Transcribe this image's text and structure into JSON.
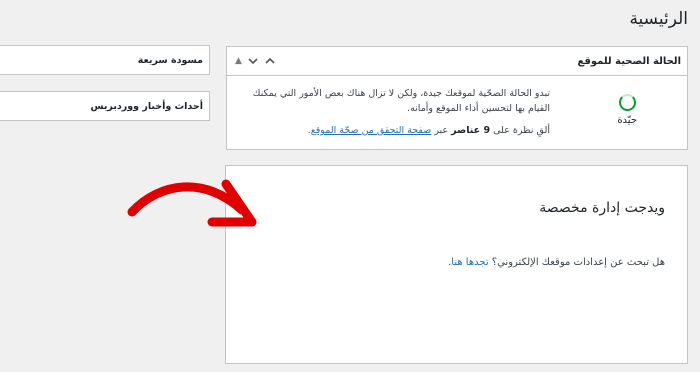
{
  "page": {
    "title": "الرئيسية"
  },
  "site_health": {
    "title": "الحالة الصحية للموقع",
    "status_label": "جيّدة",
    "paragraph1": "تبدو الحالة الصحّية لموقعك جيدة، ولكن لا تزال هناك بعض الأمور التي يمكنك القيام بها لتحسين أداء الموقع وأمانه.",
    "p2_prefix": "ألقِ نظرة على ",
    "p2_count": "9 عناصر",
    "p2_mid": " عبر ",
    "p2_link": "صفحة التحقق من صحّة الموقع",
    "p2_suffix": "."
  },
  "handles": {
    "up": "▲",
    "down": "▼",
    "up_arrow": "⌃"
  },
  "side": {
    "quick_draft": "مسودة سريعة",
    "wp_news": "أحداث وأخبار ووردبريس"
  },
  "custom_widget": {
    "title": "ويدجت إدارة مخصصة",
    "text_prefix": "هل تبحث عن إعدادات موقعك الإلكتروني؟ ",
    "link": "تجدها هنا",
    "text_suffix": "."
  },
  "colors": {
    "accent": "#2271b1",
    "good": "#00a32a",
    "annotation": "#e00000"
  }
}
